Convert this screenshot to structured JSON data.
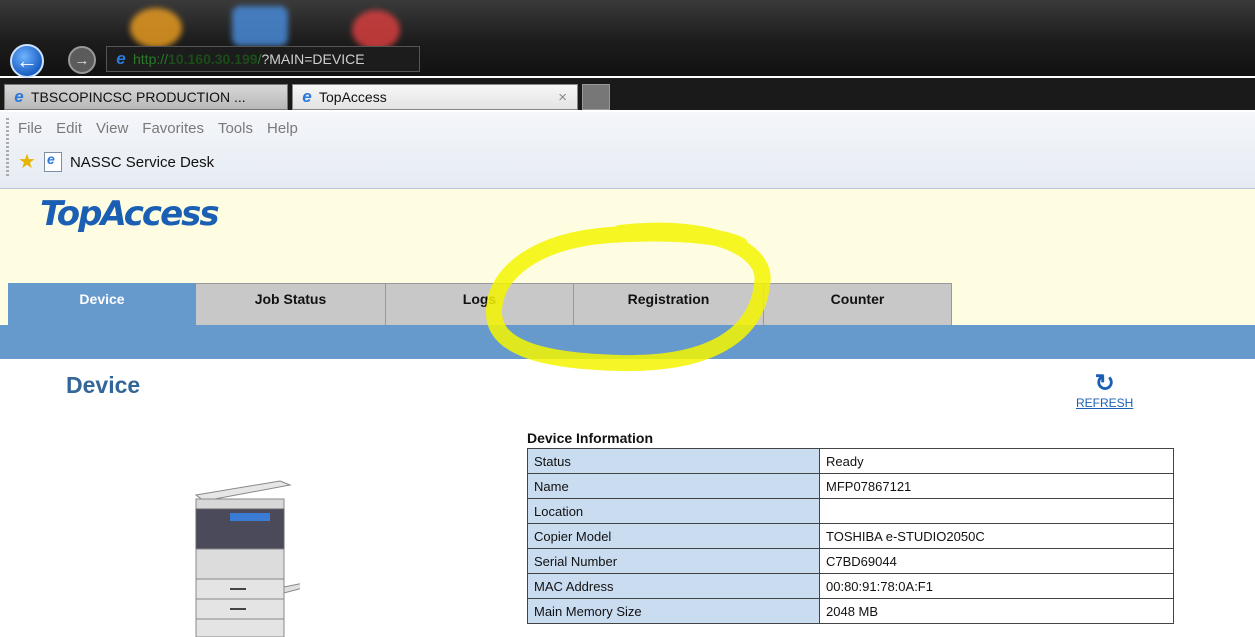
{
  "browser": {
    "address": {
      "prefix": "http://",
      "host": "10.160.30.199",
      "slash": "/",
      "path": "?MAIN=DEVICE"
    },
    "tabs": [
      {
        "label": "TBSCOPINCSC PRODUCTION ..."
      },
      {
        "label": "TopAccess"
      }
    ],
    "close_glyph": "×",
    "menu": [
      "File",
      "Edit",
      "View",
      "Favorites",
      "Tools",
      "Help"
    ],
    "favorites": [
      {
        "label": "NASSC Service Desk"
      }
    ]
  },
  "app": {
    "logo": "TopAccess",
    "tabs": [
      {
        "label": "Device",
        "active": true
      },
      {
        "label": "Job Status",
        "active": false
      },
      {
        "label": "Logs",
        "active": false
      },
      {
        "label": "Registration",
        "active": false
      },
      {
        "label": "Counter",
        "active": false
      }
    ],
    "page_title": "Device",
    "refresh_label": "REFRESH"
  },
  "device_info": {
    "caption": "Device Information",
    "rows": [
      {
        "key": "Status",
        "value": "Ready"
      },
      {
        "key": "Name",
        "value": "MFP07867121"
      },
      {
        "key": "Location",
        "value": ""
      },
      {
        "key": "Copier Model",
        "value": "TOSHIBA e-STUDIO2050C"
      },
      {
        "key": "Serial Number",
        "value": "C7BD69044"
      },
      {
        "key": "MAC Address",
        "value": "00:80:91:78:0A:F1"
      },
      {
        "key": "Main Memory Size",
        "value": "2048 MB"
      }
    ]
  },
  "colors": {
    "accent_blue": "#6699cc",
    "header_bg": "#fffde1",
    "title_blue": "#336699",
    "highlight_yellow": "#fcff00"
  }
}
